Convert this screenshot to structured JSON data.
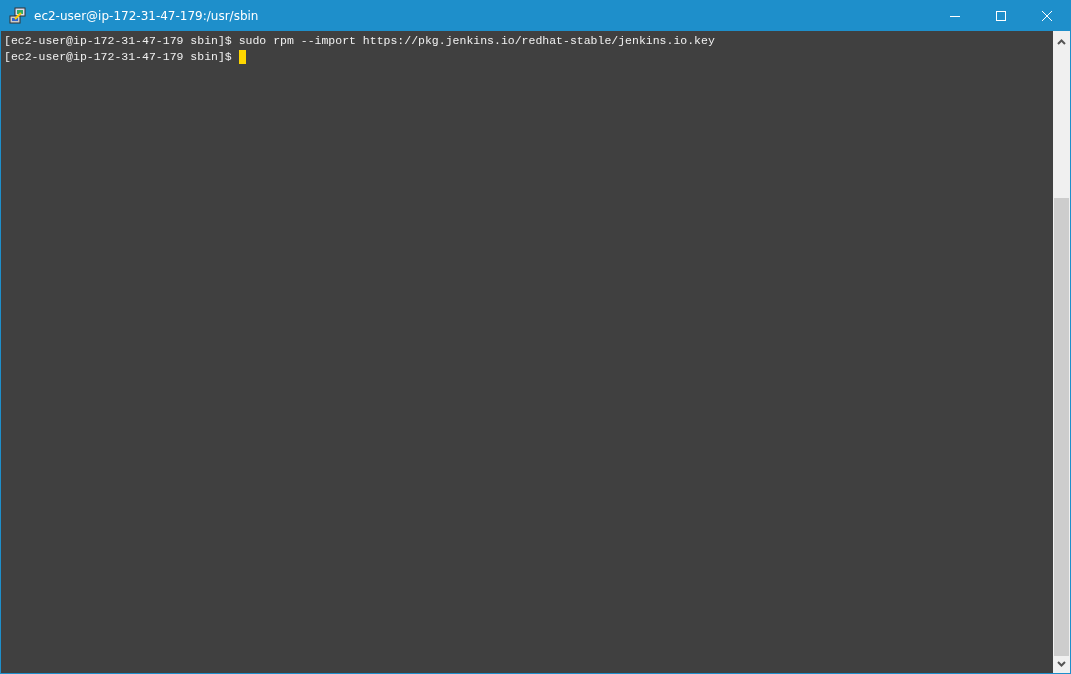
{
  "window": {
    "title": "ec2-user@ip-172-31-47-179:/usr/sbin"
  },
  "terminal": {
    "lines": [
      {
        "text": "[ec2-user@ip-172-31-47-179 sbin]$ sudo rpm --import https://pkg.jenkins.io/redhat-stable/jenkins.io.key",
        "cursor": false
      },
      {
        "text": "[ec2-user@ip-172-31-47-179 sbin]$",
        "cursor": true
      }
    ]
  }
}
